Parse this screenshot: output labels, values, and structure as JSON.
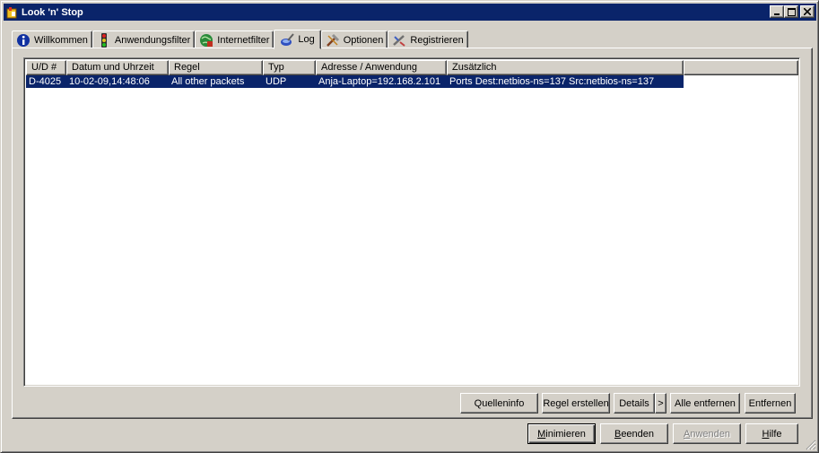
{
  "window": {
    "title": "Look 'n' Stop"
  },
  "title_buttons": {
    "minimize": "_",
    "maximize": "□",
    "close": "×"
  },
  "tabs": [
    {
      "label": "Willkommen",
      "icon": "info-icon"
    },
    {
      "label": "Anwendungsfilter",
      "icon": "traffic-light-icon"
    },
    {
      "label": "Internetfilter",
      "icon": "globe-icon"
    },
    {
      "label": "Log",
      "icon": "log-icon",
      "active": true
    },
    {
      "label": "Optionen",
      "icon": "tools-icon"
    },
    {
      "label": "Registrieren",
      "icon": "register-icon"
    }
  ],
  "log": {
    "columns": [
      "U/D #",
      "Datum und Uhrzeit",
      "Regel",
      "Typ",
      "Adresse / Anwendung",
      "Zusätzlich",
      ""
    ],
    "rows": [
      [
        "D-4025",
        "10-02-09,14:48:06",
        "All other packets",
        "UDP",
        "Anja-Laptop=192.168.2.101",
        "Ports Dest:netbios-ns=137 Src:netbios-ns=137"
      ]
    ]
  },
  "panel_buttons": {
    "source_info": "Quelleninfo",
    "create_rule": "Regel erstellen",
    "details": "Details",
    "details_arrow": ">",
    "remove_all": "Alle entfernen",
    "remove": "Entfernen"
  },
  "dialog_buttons": {
    "minimize": {
      "first": "M",
      "rest": "inimieren"
    },
    "quit": {
      "first": "B",
      "rest": "eenden"
    },
    "apply": {
      "first": "A",
      "rest": "nwenden"
    },
    "help": {
      "first": "H",
      "rest": "ilfe"
    }
  },
  "colors": {
    "title_bar": "#0a246a",
    "selection": "#0a246a",
    "face": "#d4d0c8"
  }
}
